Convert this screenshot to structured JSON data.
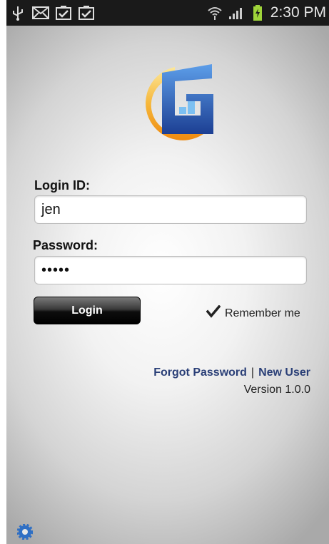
{
  "status_bar": {
    "time": "2:30 PM",
    "left_icons": [
      "usb-icon",
      "email-icon",
      "checklist-icon",
      "checklist-icon"
    ],
    "right_icons": [
      "wifi-icon",
      "signal-icon",
      "battery-charging-icon"
    ]
  },
  "form": {
    "login_id_label": "Login ID:",
    "login_id_value": "jen",
    "password_label": "Password:",
    "password_masked": "•••••",
    "login_button": "Login",
    "remember_label": "Remember me",
    "remember_checked": true
  },
  "links": {
    "forgot_password": "Forgot Password",
    "separator": "|",
    "new_user": "New User"
  },
  "version": "Version 1.0.0",
  "colors": {
    "link": "#2a3f77",
    "logo_blue": "#2b5cb8",
    "logo_orange": "#f29a1b"
  }
}
